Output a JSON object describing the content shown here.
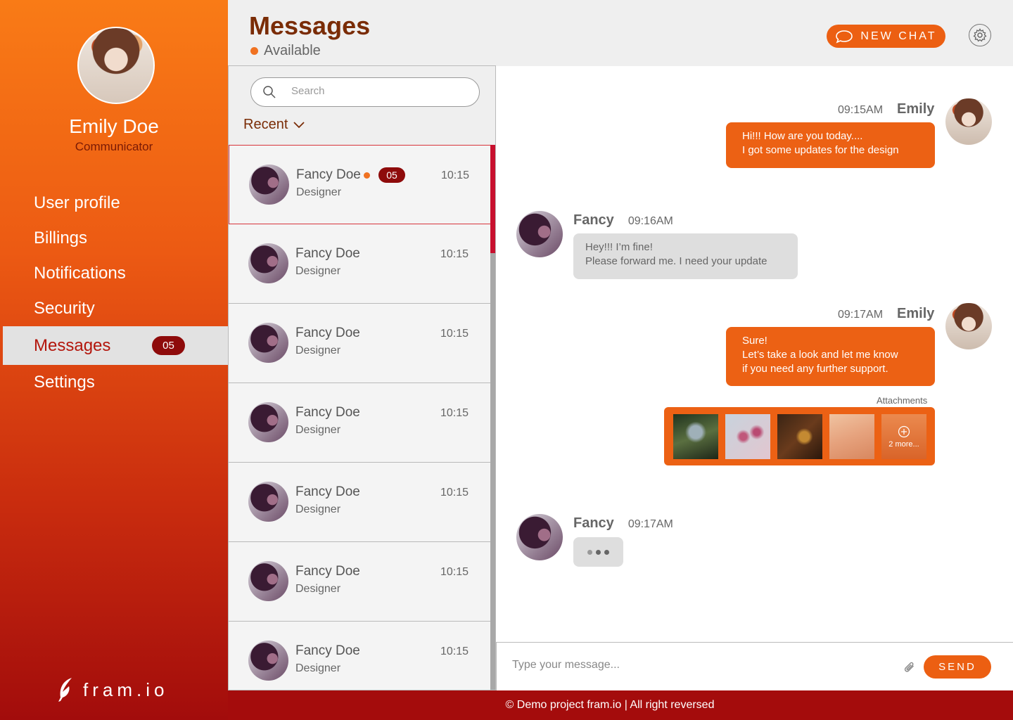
{
  "user": {
    "name": "Emily Doe",
    "role": "Communicator"
  },
  "nav": {
    "items": [
      {
        "label": "User profile"
      },
      {
        "label": "Billings"
      },
      {
        "label": "Notifications"
      },
      {
        "label": "Security"
      },
      {
        "label": "Messages",
        "badge": "05",
        "active": true
      },
      {
        "label": "Settings"
      }
    ]
  },
  "logo": {
    "text": "fram.io"
  },
  "header": {
    "title": "Messages",
    "status": "Available",
    "new_chat_label": "NEW CHAT"
  },
  "search": {
    "placeholder": "Search"
  },
  "filter": {
    "label": "Recent"
  },
  "contacts": [
    {
      "name": "Fancy Doe",
      "role": "Designer",
      "time": "10:15",
      "online": true,
      "badge": "05",
      "selected": true
    },
    {
      "name": "Fancy Doe",
      "role": "Designer",
      "time": "10:15"
    },
    {
      "name": "Fancy Doe",
      "role": "Designer",
      "time": "10:15"
    },
    {
      "name": "Fancy Doe",
      "role": "Designer",
      "time": "10:15"
    },
    {
      "name": "Fancy Doe",
      "role": "Designer",
      "time": "10:15"
    },
    {
      "name": "Fancy Doe",
      "role": "Designer",
      "time": "10:15"
    },
    {
      "name": "Fancy Doe",
      "role": "Designer",
      "time": "10:15"
    }
  ],
  "messages": [
    {
      "sender": "Emily",
      "time": "09:15AM",
      "lines": [
        "Hi!!! How are you today....",
        "I got some updates for the design"
      ]
    },
    {
      "sender": "Fancy",
      "time": "09:16AM",
      "lines": [
        "Hey!!! I’m fine!",
        "Please forward me. I need your update"
      ]
    },
    {
      "sender": "Emily",
      "time": "09:17AM",
      "lines": [
        "Sure!",
        "Let’s take a look and let me know",
        "if you need any further support."
      ]
    },
    {
      "sender": "Fancy",
      "time": "09:17AM",
      "typing": true
    }
  ],
  "attachments": {
    "label": "Attachments",
    "more_label": "2 more..."
  },
  "composer": {
    "placeholder": "Type your message...",
    "send_label": "SEND"
  },
  "footer": {
    "text": "© Demo project fram.io | All right reversed"
  },
  "colors": {
    "accent": "#ec5f12",
    "dark_red": "#8e0b0b",
    "title": "#7a2c06"
  }
}
